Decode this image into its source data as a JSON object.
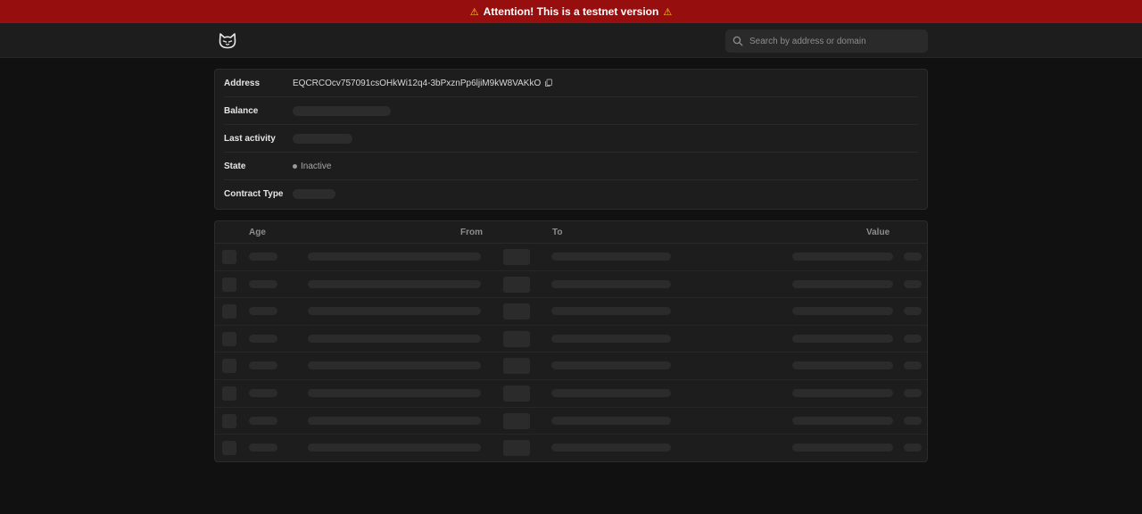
{
  "banner": {
    "text": "Attention! This is a testnet version",
    "warn_glyph": "⚠",
    "accent": "#960e0e"
  },
  "header": {
    "logo_icon": "cat-face-icon",
    "search": {
      "placeholder": "Search by address or domain",
      "value": ""
    }
  },
  "account": {
    "address_label": "Address",
    "address_value": "EQCRCOcv757091csOHkWi12q4-3bPxznPp6ljiM9kW8VAKkO",
    "balance_label": "Balance",
    "last_activity_label": "Last activity",
    "state_label": "State",
    "state_value": "Inactive",
    "contract_type_label": "Contract Type"
  },
  "transactions": {
    "columns": {
      "age": "Age",
      "from": "From",
      "to": "To",
      "value": "Value"
    },
    "loading_rows": 8
  }
}
